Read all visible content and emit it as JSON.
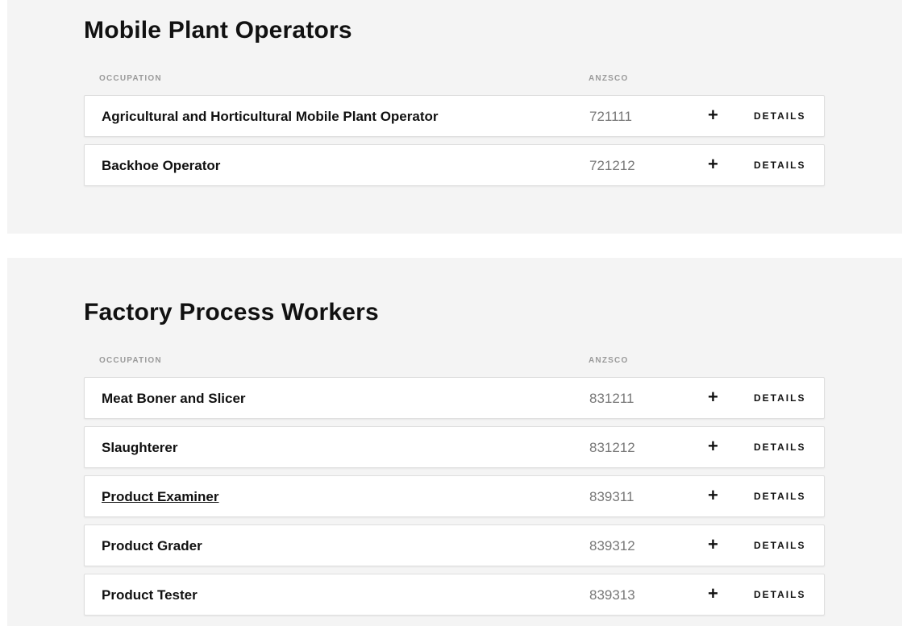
{
  "sections": [
    {
      "title": "Mobile Plant Operators",
      "headers": {
        "occupation": "OCCUPATION",
        "anzsco": "ANZSCO"
      },
      "rows": [
        {
          "name": "Agricultural and Horticultural Mobile Plant Operator",
          "code": "721111",
          "plus": "+",
          "details": "DETAILS"
        },
        {
          "name": "Backhoe Operator",
          "code": "721212",
          "plus": "+",
          "details": "DETAILS"
        }
      ]
    },
    {
      "title": "Factory Process Workers",
      "headers": {
        "occupation": "OCCUPATION",
        "anzsco": "ANZSCO"
      },
      "rows": [
        {
          "name": "Meat Boner and Slicer",
          "code": "831211",
          "plus": "+",
          "details": "DETAILS"
        },
        {
          "name": "Slaughterer",
          "code": "831212",
          "plus": "+",
          "details": "DETAILS"
        },
        {
          "name": "Product Examiner",
          "code": "839311",
          "plus": "+",
          "details": "DETAILS",
          "hovered": true
        },
        {
          "name": "Product Grader",
          "code": "839312",
          "plus": "+",
          "details": "DETAILS"
        },
        {
          "name": "Product Tester",
          "code": "839313",
          "plus": "+",
          "details": "DETAILS"
        }
      ]
    }
  ]
}
